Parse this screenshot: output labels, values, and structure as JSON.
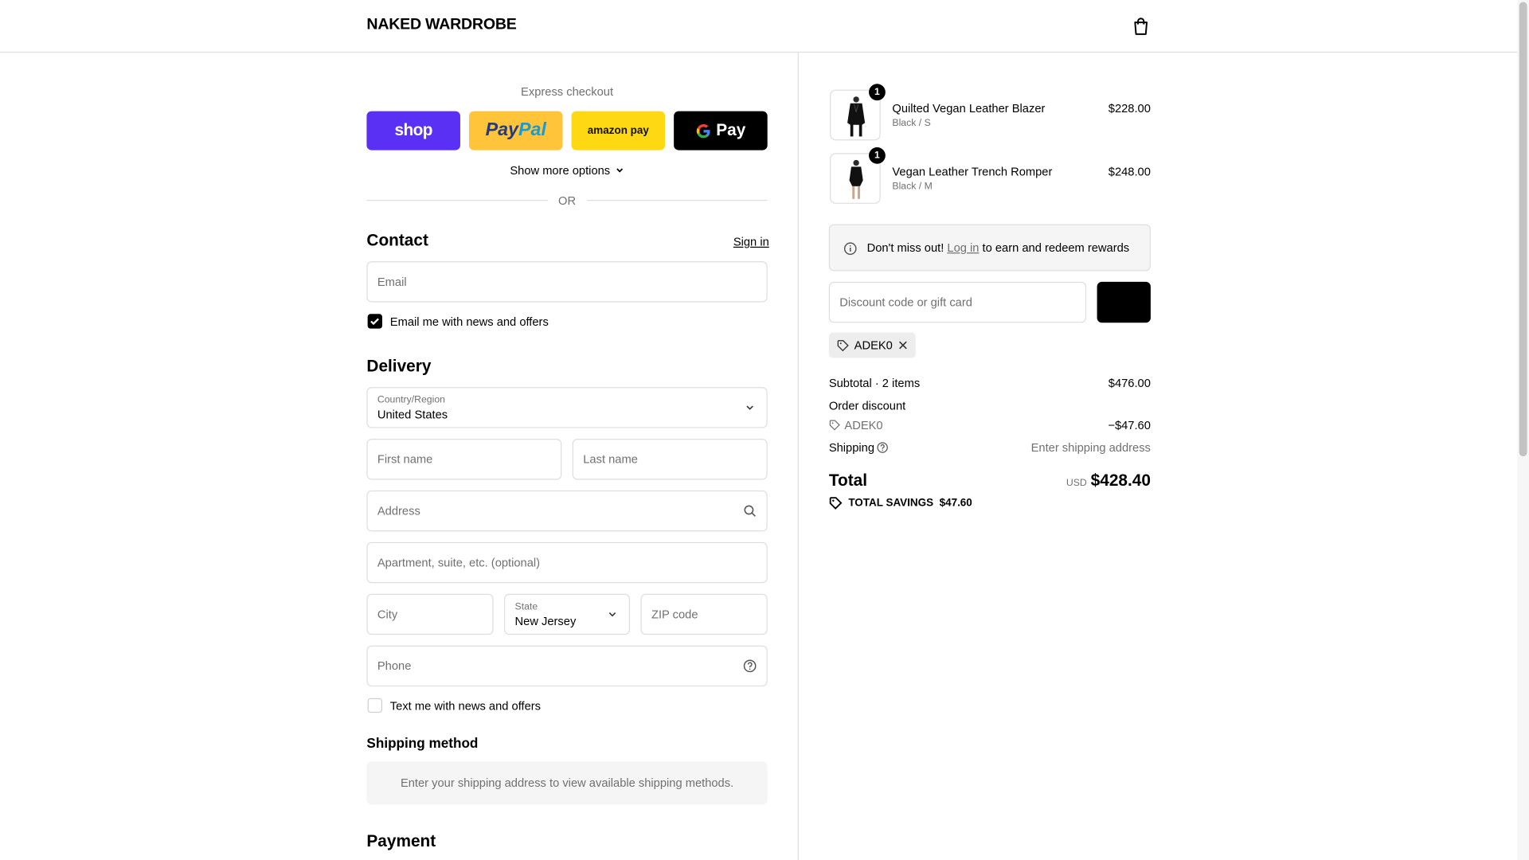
{
  "header": {
    "logo": "NAKED WARDROBE"
  },
  "express": {
    "label": "Express checkout",
    "buttons": [
      {
        "name": "shop",
        "label": "shop"
      },
      {
        "name": "paypal",
        "label": "PayPal"
      },
      {
        "name": "amazon",
        "label": "amazon pay"
      },
      {
        "name": "gpay",
        "label": "G Pay"
      }
    ],
    "more_options": "Show more options",
    "or": "OR"
  },
  "contact": {
    "title": "Contact",
    "sign_in": "Sign in",
    "email_placeholder": "Email",
    "newsletter_label": "Email me with news and offers",
    "newsletter_checked": true
  },
  "delivery": {
    "title": "Delivery",
    "country_label": "Country/Region",
    "country_value": "United States",
    "first_name_placeholder": "First name",
    "last_name_placeholder": "Last name",
    "address_placeholder": "Address",
    "apartment_placeholder": "Apartment, suite, etc. (optional)",
    "city_placeholder": "City",
    "state_label": "State",
    "state_value": "New Jersey",
    "zip_placeholder": "ZIP code",
    "phone_placeholder": "Phone",
    "sms_label": "Text me with news and offers",
    "sms_checked": false
  },
  "shipping_method": {
    "title": "Shipping method",
    "message": "Enter your shipping address to view available shipping methods."
  },
  "payment": {
    "title": "Payment"
  },
  "order": {
    "items": [
      {
        "name": "Quilted Vegan Leather Blazer",
        "variant": "Black / S",
        "price": "$228.00",
        "qty": "1"
      },
      {
        "name": "Vegan Leather Trench Romper",
        "variant": "Black / M",
        "price": "$248.00",
        "qty": "1"
      }
    ],
    "notice_prefix": "Don't miss out!",
    "notice_link": "Log in",
    "notice_suffix": "to earn and redeem rewards",
    "discount_placeholder": "Discount code or gift card",
    "applied_code": "ADEK0",
    "subtotal_label": "Subtotal · 2 items",
    "subtotal_value": "$476.00",
    "order_discount_label": "Order discount",
    "discount_code": "ADEK0",
    "discount_value": "−$47.60",
    "shipping_label": "Shipping",
    "shipping_value": "Enter shipping address",
    "total_label": "Total",
    "currency": "USD",
    "total_value": "$428.40",
    "savings_label": "TOTAL SAVINGS",
    "savings_value": "$47.60"
  },
  "colors": {
    "shop_purple": "#5a31f4",
    "paypal_yellow": "#ffc439",
    "amazon_yellow": "#ffd814",
    "border": "#dedede",
    "muted_text": "#707070"
  }
}
